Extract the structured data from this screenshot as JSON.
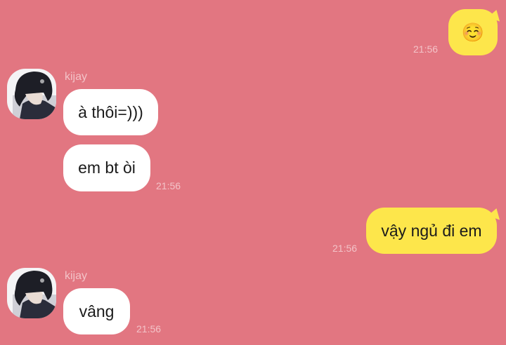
{
  "chat": {
    "messages": [
      {
        "id": "m1",
        "direction": "outgoing",
        "text": "☺️",
        "time": "21:56"
      },
      {
        "id": "m2",
        "direction": "incoming",
        "sender": "kijay",
        "text": "à thôi=)))"
      },
      {
        "id": "m3",
        "direction": "incoming",
        "text": "em bt òi",
        "time": "21:56"
      },
      {
        "id": "m4",
        "direction": "outgoing",
        "text": "vậy ngủ đi em",
        "time": "21:56"
      },
      {
        "id": "m5",
        "direction": "incoming",
        "sender": "kijay",
        "text": "vâng",
        "time": "21:56"
      }
    ]
  },
  "colors": {
    "background": "#e27681",
    "outgoing_bubble": "#fde64b",
    "incoming_bubble": "#ffffff",
    "meta_text": "#f3c3c8"
  }
}
